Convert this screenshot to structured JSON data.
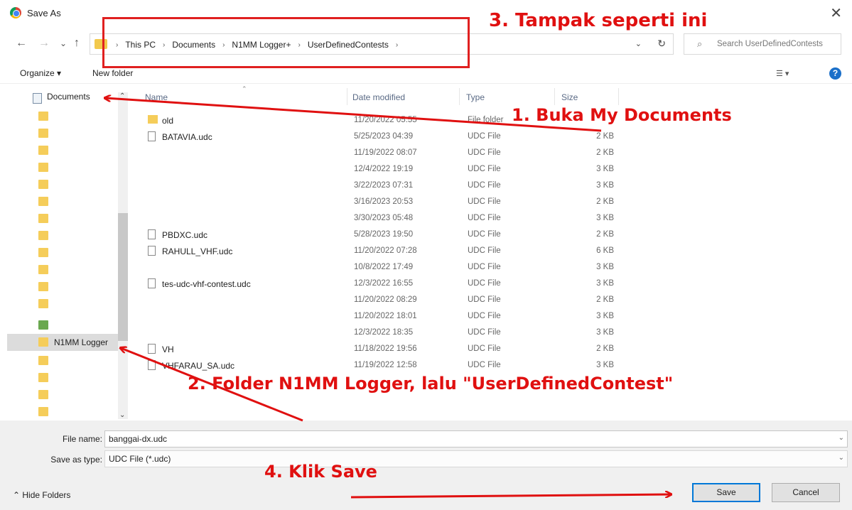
{
  "window": {
    "title": "Save As",
    "close_glyph": "✕"
  },
  "nav": {
    "back": "←",
    "forward": "→",
    "recent": "⌄",
    "up": "↑",
    "breadcrumbs": [
      "This PC",
      "Documents",
      "N1MM Logger+",
      "UserDefinedContests"
    ],
    "separator": "›",
    "refresh": "↻",
    "dropdown": "⌄"
  },
  "search": {
    "icon": "search-icon",
    "placeholder": "Search UserDefinedContests"
  },
  "toolbar": {
    "organize": "Organize ▾",
    "new_folder": "New folder",
    "view": "☰ ▾",
    "help": "?"
  },
  "sidebar": {
    "items": [
      {
        "label": "Documents",
        "icon": "documents-icon"
      },
      {
        "label": "",
        "icon": "folder-icon"
      },
      {
        "label": "",
        "icon": "folder-icon"
      },
      {
        "label": "",
        "icon": "folder-icon"
      },
      {
        "label": "",
        "icon": "folder-icon"
      },
      {
        "label": "",
        "icon": "folder-icon"
      },
      {
        "label": "",
        "icon": "folder-icon"
      },
      {
        "label": "",
        "icon": "folder-icon"
      },
      {
        "label": "",
        "icon": "folder-icon"
      },
      {
        "label": "",
        "icon": "folder-icon"
      },
      {
        "label": "",
        "icon": "folder-icon"
      },
      {
        "label": "",
        "icon": "folder-icon"
      },
      {
        "label": "N1MM Logger",
        "icon": "folder-icon"
      },
      {
        "label": "",
        "icon": "folder-icon"
      },
      {
        "label": "",
        "icon": "folder-icon"
      },
      {
        "label": "",
        "icon": "folder-icon"
      },
      {
        "label": "",
        "icon": "folder-icon"
      }
    ]
  },
  "columns": {
    "name": "Name",
    "date": "Date modified",
    "type": "Type",
    "size": "Size"
  },
  "files": [
    {
      "name": "old",
      "date": "11/20/2022 05:55",
      "type": "File folder",
      "size": "",
      "icon": "folder-icon"
    },
    {
      "name": "BATAVIA.udc",
      "date": "5/25/2023 04:39",
      "type": "UDC File",
      "size": "2 KB",
      "icon": "file-icon"
    },
    {
      "name": "",
      "date": "11/19/2022 08:07",
      "type": "UDC File",
      "size": "2 KB",
      "icon": ""
    },
    {
      "name": "",
      "date": "12/4/2022 19:19",
      "type": "UDC File",
      "size": "3 KB",
      "icon": ""
    },
    {
      "name": "",
      "date": "3/22/2023 07:31",
      "type": "UDC File",
      "size": "3 KB",
      "icon": ""
    },
    {
      "name": "",
      "date": "3/16/2023 20:53",
      "type": "UDC File",
      "size": "2 KB",
      "icon": ""
    },
    {
      "name": "",
      "date": "3/30/2023 05:48",
      "type": "UDC File",
      "size": "3 KB",
      "icon": ""
    },
    {
      "name": "PBDXC.udc",
      "date": "5/28/2023 19:50",
      "type": "UDC File",
      "size": "2 KB",
      "icon": "file-icon"
    },
    {
      "name": "RAHULL_VHF.udc",
      "date": "11/20/2022 07:28",
      "type": "UDC File",
      "size": "6 KB",
      "icon": "file-icon"
    },
    {
      "name": "",
      "date": "10/8/2022 17:49",
      "type": "UDC File",
      "size": "3 KB",
      "icon": ""
    },
    {
      "name": "tes-udc-vhf-contest.udc",
      "date": "12/3/2022 16:55",
      "type": "UDC File",
      "size": "3 KB",
      "icon": "file-icon"
    },
    {
      "name": "",
      "date": "11/20/2022 08:29",
      "type": "UDC File",
      "size": "2 KB",
      "icon": ""
    },
    {
      "name": "",
      "date": "11/20/2022 18:01",
      "type": "UDC File",
      "size": "3 KB",
      "icon": ""
    },
    {
      "name": "",
      "date": "12/3/2022 18:35",
      "type": "UDC File",
      "size": "3 KB",
      "icon": ""
    },
    {
      "name": "VH",
      "date": "11/18/2022 19:56",
      "type": "UDC File",
      "size": "2 KB",
      "icon": "file-icon"
    },
    {
      "name": "VHFARAU_SA.udc",
      "date": "11/19/2022 12:58",
      "type": "UDC File",
      "size": "3 KB",
      "icon": "file-icon"
    }
  ],
  "footer": {
    "file_name_label": "File name:",
    "file_name_value": "banggai-dx.udc",
    "save_type_label": "Save as type:",
    "save_type_value": "UDC File (*.udc)",
    "hide_folders": "⌃ Hide Folders",
    "save": "Save",
    "cancel": "Cancel"
  },
  "annotations": {
    "step1": "1. Buka My Documents",
    "step2": "2. Folder N1MM Logger, lalu \"UserDefinedContest\"",
    "step3": "3. Tampak seperti ini",
    "step4": "4. Klik Save",
    "color": "#e01010"
  }
}
